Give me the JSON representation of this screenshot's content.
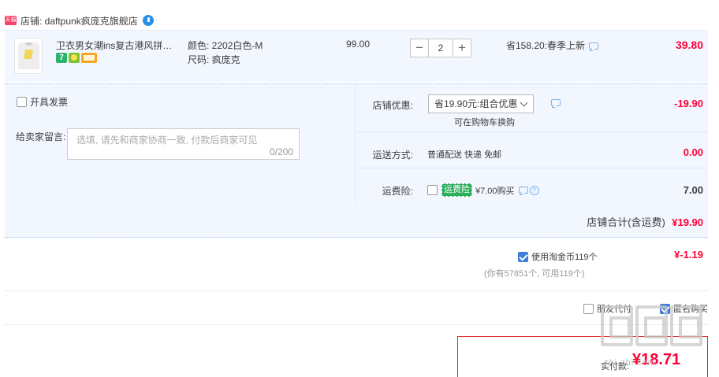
{
  "shop": {
    "badge_text": "天猫",
    "name": "店铺: daftpunk疯庞克旗舰店"
  },
  "item": {
    "title": "卫衣男女潮ins复古港风拼色春…",
    "sku_color": "颜色: 2202白色-M",
    "sku_size": "尺码: 疯庞克",
    "unit_price": "99.00",
    "quantity": "2",
    "qty_minus": "−",
    "qty_plus": "+",
    "promotion": "省158.20:春季上新",
    "total": "39.80",
    "service_7day": "7"
  },
  "order": {
    "invoice_label": "开具发票",
    "memo_label": "给卖家留言:",
    "memo_placeholder": "选填, 请先和商家协商一致, 付款后商家可见",
    "memo_count": "0/200",
    "shop_discount_label": "店铺优惠:",
    "shop_discount_value": "省19.90元:组合优惠",
    "shop_discount_note": "可在购物车换购",
    "shop_discount_amount": "-19.90",
    "shipping_label": "运送方式:",
    "shipping_value": "普通配送 快递 免邮",
    "shipping_amount": "0.00",
    "insurance_label": "运费险:",
    "insurance_badge": "运费险",
    "insurance_price": "¥7.00购买",
    "insurance_amount": "7.00"
  },
  "subtotal": {
    "label": "店铺合计(含运费)",
    "amount": "¥19.90"
  },
  "coins": {
    "label": "使用淘金币119个",
    "note": "(你有57851个, 可用119个)",
    "amount": "¥-1.19"
  },
  "options": {
    "friend_pay": "朋友代付",
    "anonymous": "匿名购买"
  },
  "payment": {
    "label": "实付款:",
    "amount": "¥18.71"
  },
  "watermark": {
    "url": "zhi.zhi.com"
  }
}
